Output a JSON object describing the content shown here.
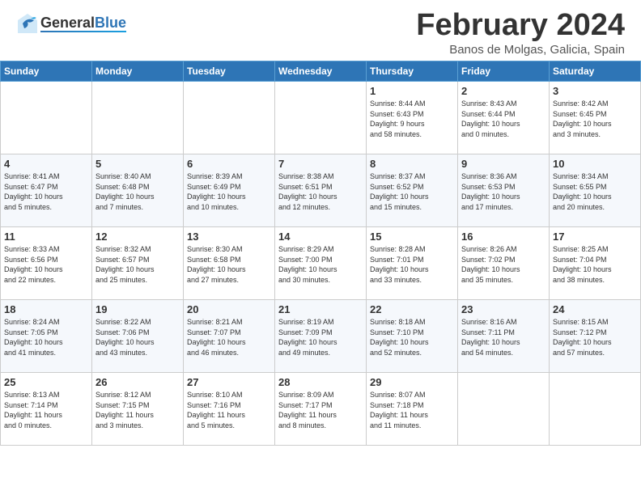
{
  "header": {
    "logo_general": "General",
    "logo_blue": "Blue",
    "title": "February 2024",
    "subtitle": "Banos de Molgas, Galicia, Spain"
  },
  "weekdays": [
    "Sunday",
    "Monday",
    "Tuesday",
    "Wednesday",
    "Thursday",
    "Friday",
    "Saturday"
  ],
  "weeks": [
    [
      {
        "day": "",
        "info": ""
      },
      {
        "day": "",
        "info": ""
      },
      {
        "day": "",
        "info": ""
      },
      {
        "day": "",
        "info": ""
      },
      {
        "day": "1",
        "info": "Sunrise: 8:44 AM\nSunset: 6:43 PM\nDaylight: 9 hours\nand 58 minutes."
      },
      {
        "day": "2",
        "info": "Sunrise: 8:43 AM\nSunset: 6:44 PM\nDaylight: 10 hours\nand 0 minutes."
      },
      {
        "day": "3",
        "info": "Sunrise: 8:42 AM\nSunset: 6:45 PM\nDaylight: 10 hours\nand 3 minutes."
      }
    ],
    [
      {
        "day": "4",
        "info": "Sunrise: 8:41 AM\nSunset: 6:47 PM\nDaylight: 10 hours\nand 5 minutes."
      },
      {
        "day": "5",
        "info": "Sunrise: 8:40 AM\nSunset: 6:48 PM\nDaylight: 10 hours\nand 7 minutes."
      },
      {
        "day": "6",
        "info": "Sunrise: 8:39 AM\nSunset: 6:49 PM\nDaylight: 10 hours\nand 10 minutes."
      },
      {
        "day": "7",
        "info": "Sunrise: 8:38 AM\nSunset: 6:51 PM\nDaylight: 10 hours\nand 12 minutes."
      },
      {
        "day": "8",
        "info": "Sunrise: 8:37 AM\nSunset: 6:52 PM\nDaylight: 10 hours\nand 15 minutes."
      },
      {
        "day": "9",
        "info": "Sunrise: 8:36 AM\nSunset: 6:53 PM\nDaylight: 10 hours\nand 17 minutes."
      },
      {
        "day": "10",
        "info": "Sunrise: 8:34 AM\nSunset: 6:55 PM\nDaylight: 10 hours\nand 20 minutes."
      }
    ],
    [
      {
        "day": "11",
        "info": "Sunrise: 8:33 AM\nSunset: 6:56 PM\nDaylight: 10 hours\nand 22 minutes."
      },
      {
        "day": "12",
        "info": "Sunrise: 8:32 AM\nSunset: 6:57 PM\nDaylight: 10 hours\nand 25 minutes."
      },
      {
        "day": "13",
        "info": "Sunrise: 8:30 AM\nSunset: 6:58 PM\nDaylight: 10 hours\nand 27 minutes."
      },
      {
        "day": "14",
        "info": "Sunrise: 8:29 AM\nSunset: 7:00 PM\nDaylight: 10 hours\nand 30 minutes."
      },
      {
        "day": "15",
        "info": "Sunrise: 8:28 AM\nSunset: 7:01 PM\nDaylight: 10 hours\nand 33 minutes."
      },
      {
        "day": "16",
        "info": "Sunrise: 8:26 AM\nSunset: 7:02 PM\nDaylight: 10 hours\nand 35 minutes."
      },
      {
        "day": "17",
        "info": "Sunrise: 8:25 AM\nSunset: 7:04 PM\nDaylight: 10 hours\nand 38 minutes."
      }
    ],
    [
      {
        "day": "18",
        "info": "Sunrise: 8:24 AM\nSunset: 7:05 PM\nDaylight: 10 hours\nand 41 minutes."
      },
      {
        "day": "19",
        "info": "Sunrise: 8:22 AM\nSunset: 7:06 PM\nDaylight: 10 hours\nand 43 minutes."
      },
      {
        "day": "20",
        "info": "Sunrise: 8:21 AM\nSunset: 7:07 PM\nDaylight: 10 hours\nand 46 minutes."
      },
      {
        "day": "21",
        "info": "Sunrise: 8:19 AM\nSunset: 7:09 PM\nDaylight: 10 hours\nand 49 minutes."
      },
      {
        "day": "22",
        "info": "Sunrise: 8:18 AM\nSunset: 7:10 PM\nDaylight: 10 hours\nand 52 minutes."
      },
      {
        "day": "23",
        "info": "Sunrise: 8:16 AM\nSunset: 7:11 PM\nDaylight: 10 hours\nand 54 minutes."
      },
      {
        "day": "24",
        "info": "Sunrise: 8:15 AM\nSunset: 7:12 PM\nDaylight: 10 hours\nand 57 minutes."
      }
    ],
    [
      {
        "day": "25",
        "info": "Sunrise: 8:13 AM\nSunset: 7:14 PM\nDaylight: 11 hours\nand 0 minutes."
      },
      {
        "day": "26",
        "info": "Sunrise: 8:12 AM\nSunset: 7:15 PM\nDaylight: 11 hours\nand 3 minutes."
      },
      {
        "day": "27",
        "info": "Sunrise: 8:10 AM\nSunset: 7:16 PM\nDaylight: 11 hours\nand 5 minutes."
      },
      {
        "day": "28",
        "info": "Sunrise: 8:09 AM\nSunset: 7:17 PM\nDaylight: 11 hours\nand 8 minutes."
      },
      {
        "day": "29",
        "info": "Sunrise: 8:07 AM\nSunset: 7:18 PM\nDaylight: 11 hours\nand 11 minutes."
      },
      {
        "day": "",
        "info": ""
      },
      {
        "day": "",
        "info": ""
      }
    ]
  ]
}
